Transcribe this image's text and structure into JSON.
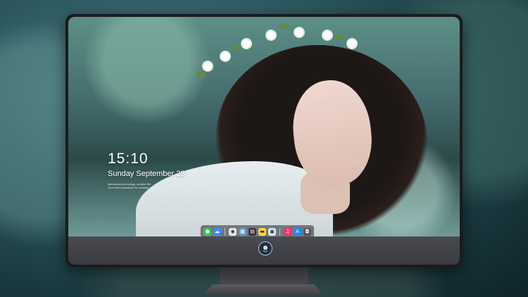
{
  "lockscreen": {
    "time": "15:10",
    "date": "Sunday September 28",
    "info_lines": [
      "Interesting technology, creative life",
      "Your best companion for desktop"
    ]
  },
  "dock": {
    "apps": [
      {
        "name": "messages-icon",
        "color": "#34c759",
        "glyph": "💬"
      },
      {
        "name": "finder-icon",
        "color": "#3a8df5",
        "glyph": "☁"
      },
      {
        "name": "safari-icon",
        "color": "#e8e8e8",
        "glyph": "◉"
      },
      {
        "name": "preview-icon",
        "color": "#5b9bd5",
        "glyph": "▦"
      },
      {
        "name": "clapper-icon",
        "color": "#333333",
        "glyph": "▤"
      },
      {
        "name": "notes-icon",
        "color": "#f5d547",
        "glyph": "▬"
      },
      {
        "name": "photos-icon",
        "color": "#d7ecff",
        "glyph": "▣"
      },
      {
        "name": "music-icon",
        "color": "#fa2d70",
        "glyph": "♫"
      },
      {
        "name": "appstore-icon",
        "color": "#1a8cff",
        "glyph": "A"
      },
      {
        "name": "camera-icon",
        "color": "#555555",
        "glyph": "◘"
      }
    ]
  }
}
